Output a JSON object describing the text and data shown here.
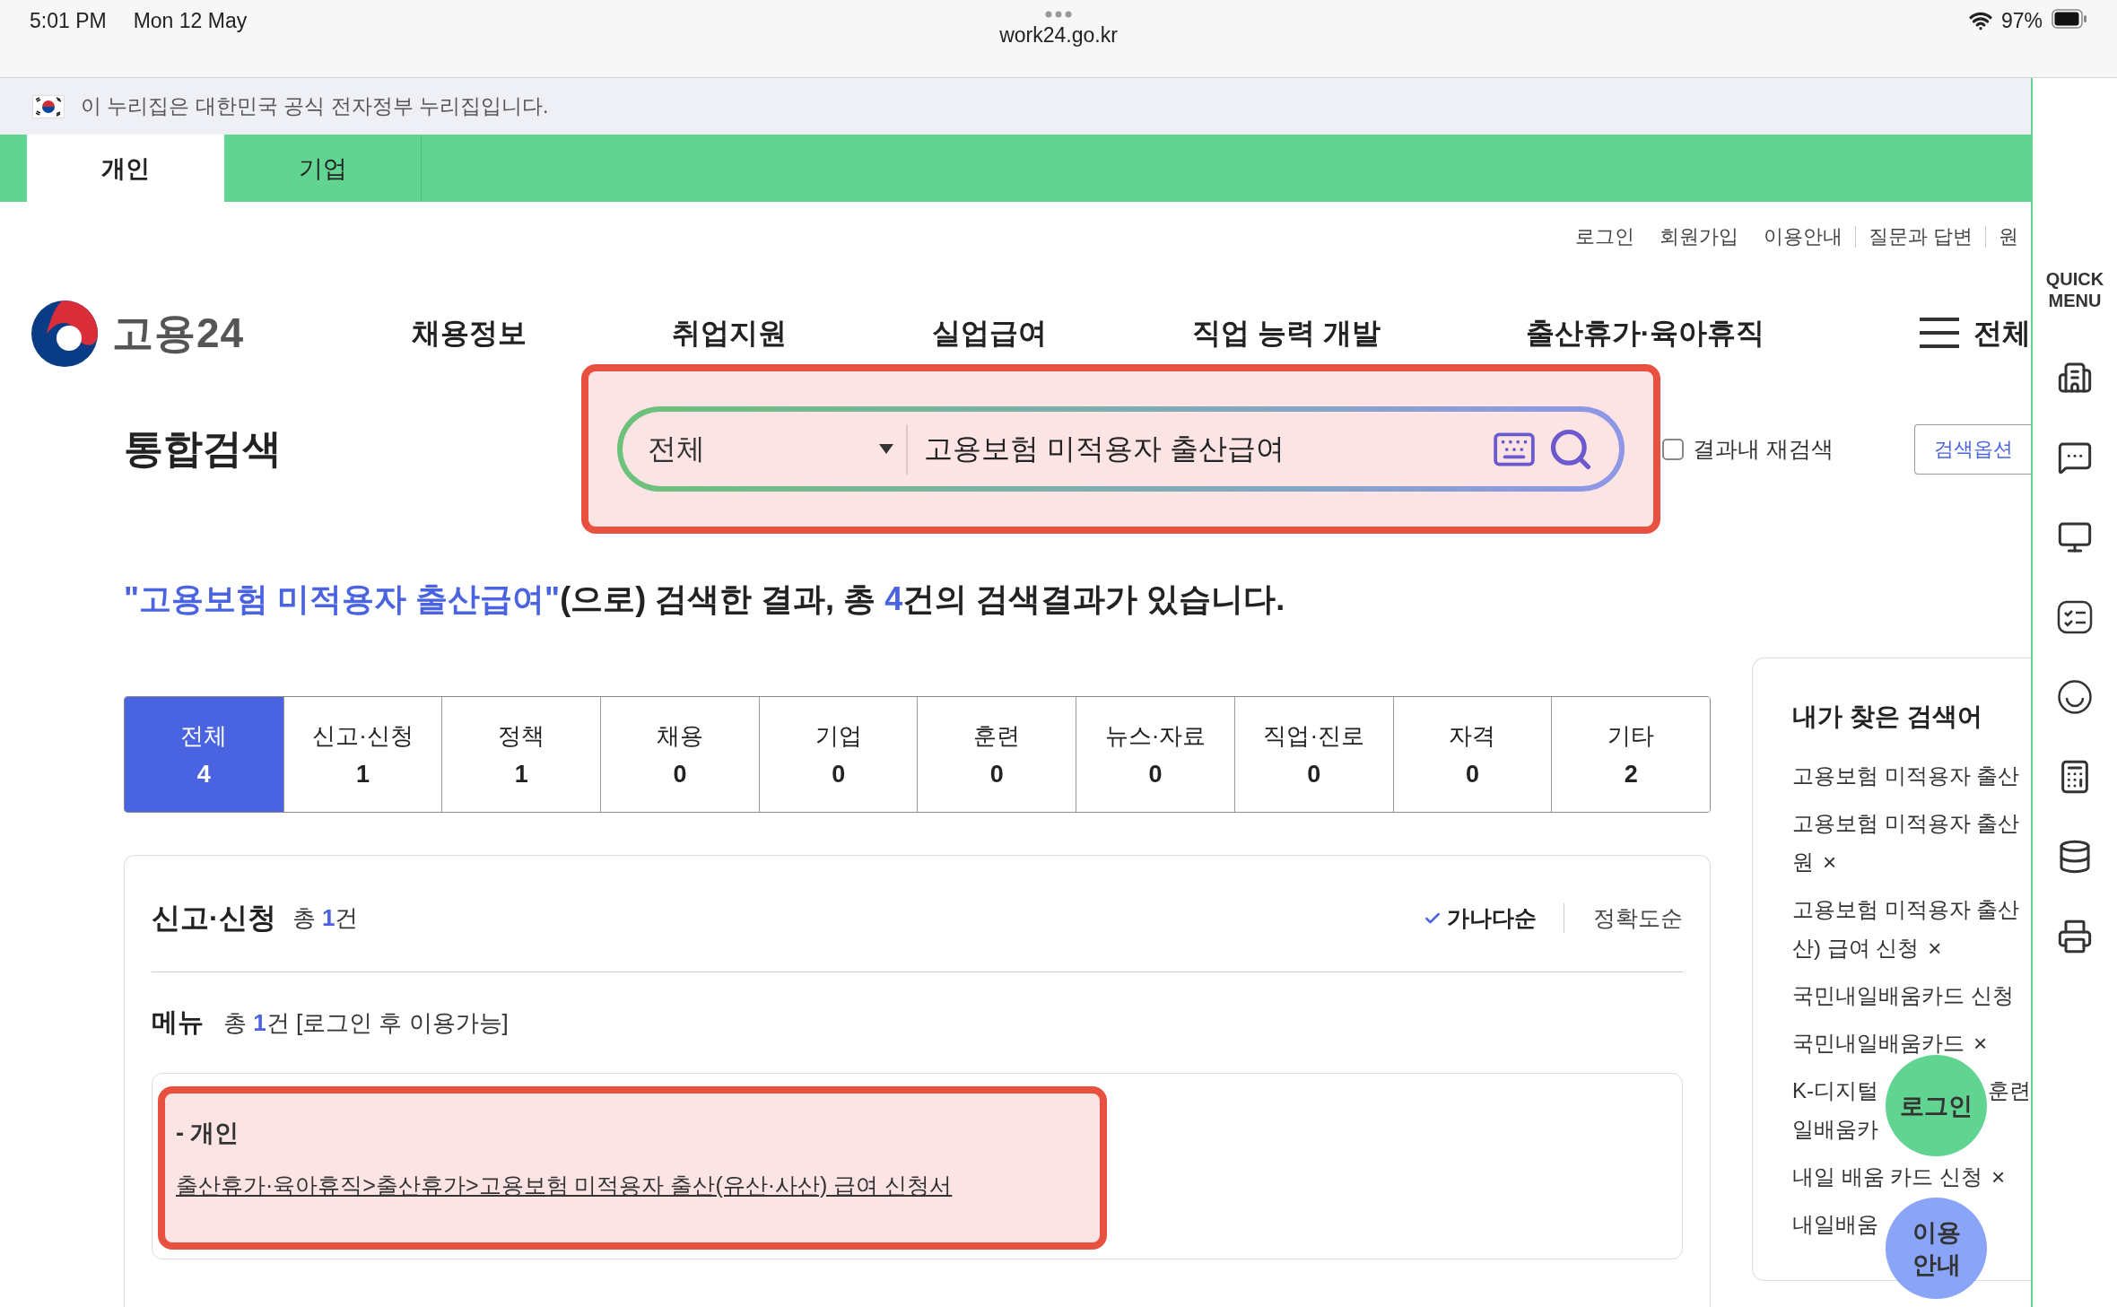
{
  "status_bar": {
    "time": "5:01 PM",
    "date": "Mon 12 May",
    "url": "work24.go.kr",
    "battery": "97%"
  },
  "gov_banner": {
    "text": "이 누리집은 대한민국 공식 전자정부 누리집입니다."
  },
  "audience_tabs": [
    {
      "label": "개인",
      "selected": true
    },
    {
      "label": "기업",
      "selected": false
    }
  ],
  "utility_links": [
    "로그인",
    "회원가입",
    "이용안내",
    "질문과 답변",
    "원"
  ],
  "logo": {
    "text": "고용24"
  },
  "nav": {
    "items": [
      "채용정보",
      "취업지원",
      "실업급여",
      "직업 능력 개발",
      "출산휴가·육아휴직"
    ],
    "all_menu": "전체"
  },
  "search": {
    "title": "통합검색",
    "scope": "전체",
    "value": "고용보험 미적용자 출산급여",
    "highlighted": true,
    "research": {
      "label": "결과내 재검색",
      "checked": false
    },
    "options_button": "검색옵션"
  },
  "result_summary": [
    {
      "text": "\"고용보험 미적용자 출산급여\"",
      "highlight": true
    },
    {
      "text": "(으로) 검색한 결과, 총 ",
      "highlight": false
    },
    {
      "text": "4",
      "highlight": true
    },
    {
      "text": "건의 검색결과가 있습니다.",
      "highlight": false
    }
  ],
  "category_tabs": [
    {
      "label": "전체",
      "count": "4",
      "selected": true
    },
    {
      "label": "신고·신청",
      "count": "1",
      "selected": false
    },
    {
      "label": "정책",
      "count": "1",
      "selected": false
    },
    {
      "label": "채용",
      "count": "0",
      "selected": false
    },
    {
      "label": "기업",
      "count": "0",
      "selected": false
    },
    {
      "label": "훈련",
      "count": "0",
      "selected": false
    },
    {
      "label": "뉴스·자료",
      "count": "0",
      "selected": false
    },
    {
      "label": "직업·진로",
      "count": "0",
      "selected": false
    },
    {
      "label": "자격",
      "count": "0",
      "selected": false
    },
    {
      "label": "기타",
      "count": "2",
      "selected": false
    }
  ],
  "results": {
    "section_title": "신고·신청",
    "count": {
      "prefix": "총 ",
      "value": "1",
      "suffix": "건"
    },
    "sort_options": [
      {
        "label": "가나다순",
        "selected": true
      },
      {
        "label": "정확도순",
        "selected": false
      }
    ],
    "menu_title": "메뉴",
    "menu_count": {
      "prefix": "총 ",
      "value": "1",
      "suffix": "건 [로그인 후 이용가능]"
    },
    "items": [
      {
        "category": "- 개인",
        "link": "출산휴가·육아휴직>출산휴가>고용보험 미적용자 출산(유산·사산) 급여 신청서",
        "highlighted": true
      }
    ]
  },
  "recent_searches": {
    "title": "내가 찾은 검색어",
    "items": [
      {
        "lines": [
          [
            "고용보험 미적용자 출산"
          ]
        ]
      },
      {
        "lines": [
          [
            "고용보험 미적용자 출산"
          ],
          [
            "원"
          ]
        ],
        "remove": "×"
      },
      {
        "lines": [
          [
            "고용보험 미적용자 출산"
          ],
          [
            "산) 급여 신청"
          ]
        ],
        "remove": "×"
      },
      {
        "lines": [
          [
            "국민내일배움카드 신청"
          ]
        ]
      },
      {
        "lines": [
          [
            "국민내일배움카드"
          ]
        ],
        "remove": "×"
      },
      {
        "lines": [
          [
            "K-디지털",
            "훈련"
          ],
          [
            "일배움카"
          ]
        ]
      },
      {
        "lines": [
          [
            "내일 배움 카드 신청"
          ]
        ],
        "remove": "×"
      },
      {
        "lines": [
          [
            "내일배움"
          ]
        ]
      }
    ]
  },
  "floating_buttons": [
    {
      "label": "로그인",
      "kind": "login"
    },
    {
      "label": "이용안내",
      "kind": "guide"
    }
  ],
  "quick_menu": {
    "title": "QUICK MENU"
  }
}
